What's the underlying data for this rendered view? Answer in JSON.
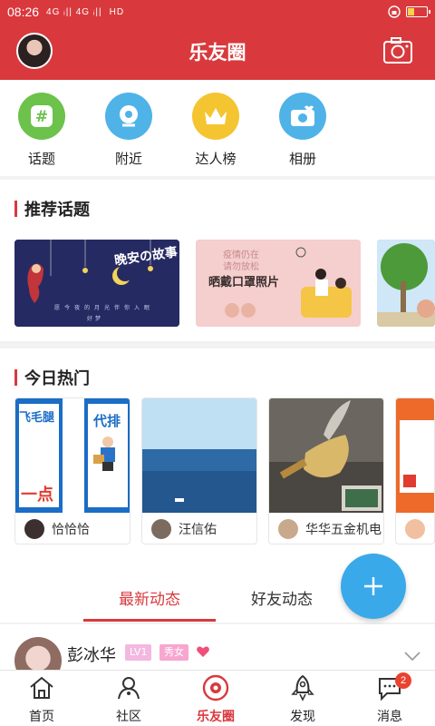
{
  "status_bar": {
    "time": "08:26",
    "signal": "4G ᵢ|| 4G ᵢ||",
    "hd": "HD",
    "battery_level": 0.35,
    "battery_color": "#f6d34c"
  },
  "header": {
    "title": "乐友圈",
    "accent": "#d9393d"
  },
  "quick_menu": [
    {
      "label": "话题",
      "icon": "hash-icon",
      "color": "#6cc24a"
    },
    {
      "label": "附近",
      "icon": "location-icon",
      "color": "#4fb3e8"
    },
    {
      "label": "达人榜",
      "icon": "crown-icon",
      "color": "#f5c431"
    },
    {
      "label": "相册",
      "icon": "camera-icon",
      "color": "#4fb3e8"
    }
  ],
  "recommended": {
    "title": "推荐话题",
    "cards": [
      {
        "caption": "晚安の故事",
        "sub": "愿今夜的月光伴你入眠",
        "sub2": "好梦"
      },
      {
        "caption": "晒戴口罩照片",
        "sub": "疫情仍在",
        "sub2": "请勿放松"
      },
      {
        "caption": ""
      }
    ]
  },
  "hot_today": {
    "title": "今日热门",
    "cards": [
      {
        "user": "恰恰恰",
        "img_text_a": "代排",
        "img_text_b": "飞毛腿",
        "img_text_c": "一点"
      },
      {
        "user": "汪信佑"
      },
      {
        "user": "华华五金机电"
      },
      {
        "user": ""
      }
    ]
  },
  "feed_tabs": {
    "latest": "最新动态",
    "friends": "好友动态"
  },
  "feed": {
    "user_name": "彭冰华",
    "level_badge": "LV1",
    "tag_badge": "秀女"
  },
  "bottom_nav": {
    "items": [
      {
        "label": "首页",
        "icon": "home-icon"
      },
      {
        "label": "社区",
        "icon": "community-icon"
      },
      {
        "label": "乐友圈",
        "icon": "circle-eye-icon"
      },
      {
        "label": "发现",
        "icon": "rocket-icon"
      },
      {
        "label": "消息",
        "icon": "message-icon"
      }
    ],
    "message_count": "2",
    "active": "乐友圈"
  }
}
